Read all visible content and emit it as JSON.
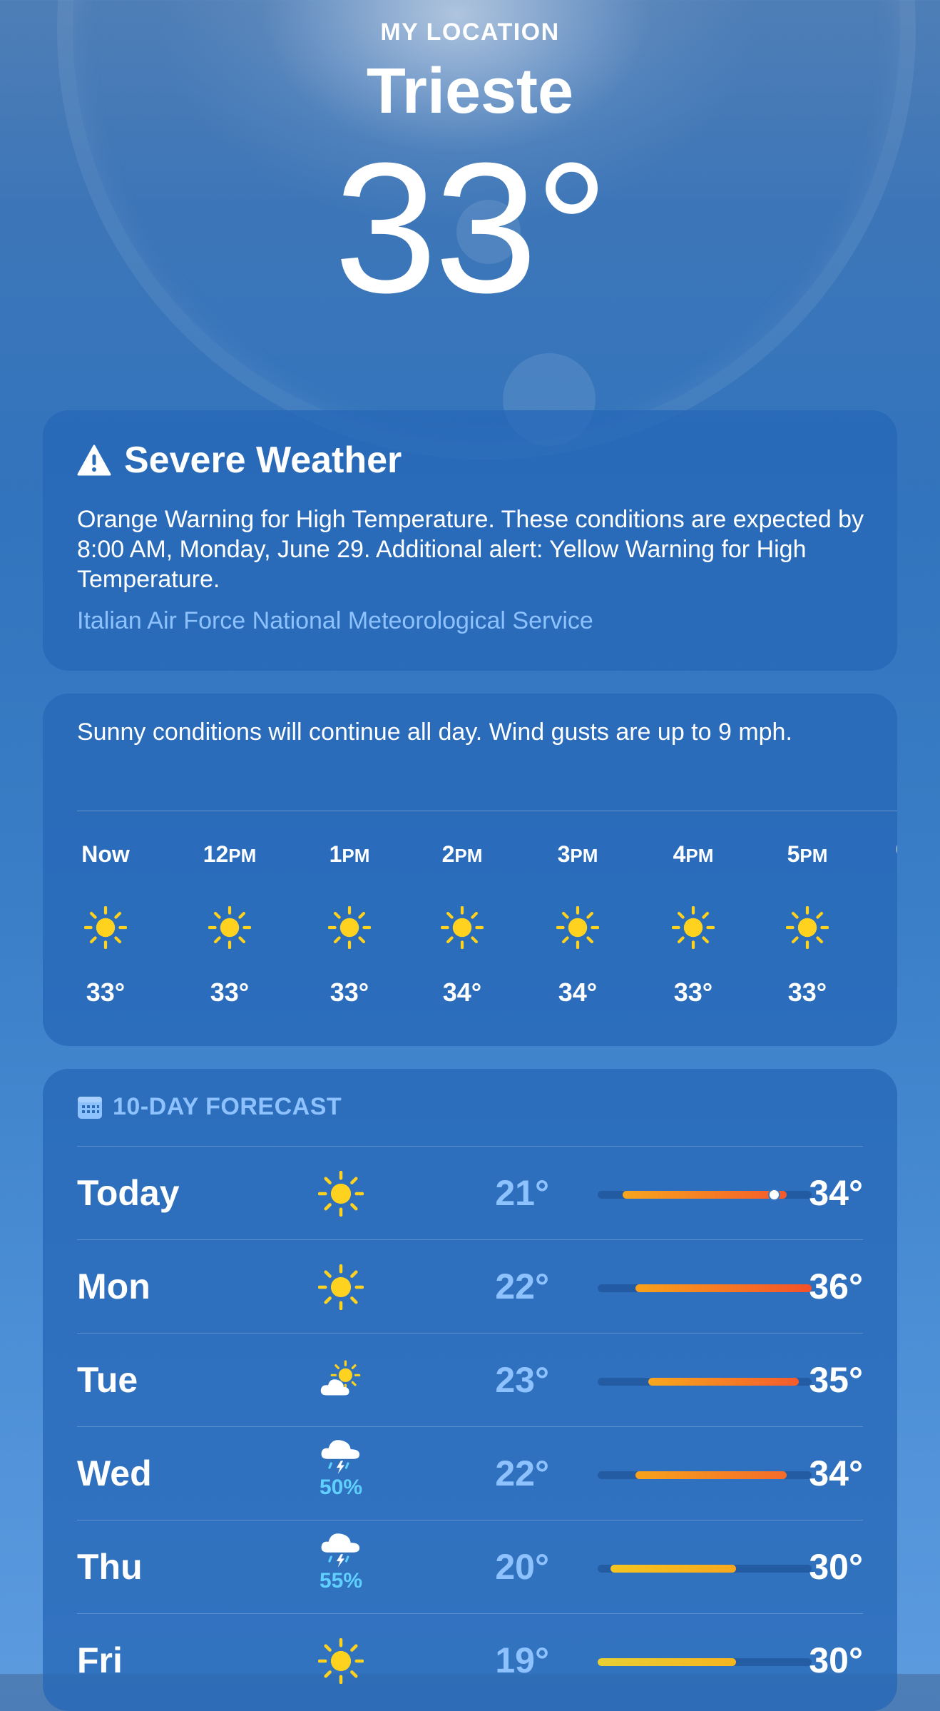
{
  "header": {
    "location_label": "MY LOCATION",
    "city": "Trieste",
    "temperature": "33°"
  },
  "alert": {
    "icon": "warning-triangle-icon",
    "title": "Severe Weather",
    "body": "Orange Warning for High Temperature. These conditions are expected by 8:00 AM, Monday, June 29. Additional alert: Yellow Warning for High Temperature.",
    "source": "Italian Air Force National Meteorological Service",
    "source_color": "#8ec2ff"
  },
  "hourly": {
    "summary": "Sunny conditions will continue all day. Wind gusts are up to 9 mph.",
    "hours": [
      {
        "label": "Now",
        "suffix": "",
        "icon": "sun-icon",
        "temp": "33°"
      },
      {
        "label": "12",
        "suffix": "PM",
        "icon": "sun-icon",
        "temp": "33°"
      },
      {
        "label": "1",
        "suffix": "PM",
        "icon": "sun-icon",
        "temp": "33°"
      },
      {
        "label": "2",
        "suffix": "PM",
        "icon": "sun-icon",
        "temp": "34°"
      },
      {
        "label": "3",
        "suffix": "PM",
        "icon": "sun-icon",
        "temp": "34°"
      },
      {
        "label": "4",
        "suffix": "PM",
        "icon": "sun-icon",
        "temp": "33°"
      },
      {
        "label": "5",
        "suffix": "PM",
        "icon": "sun-icon",
        "temp": "33°"
      }
    ]
  },
  "daily": {
    "icon": "calendar-icon",
    "title": "10-DAY FORECAST",
    "range_min": 19,
    "range_max": 36,
    "days": [
      {
        "name": "Today",
        "icon": "sun-icon",
        "precip": "",
        "low": "21°",
        "high": "34°",
        "low_val": 21,
        "high_val": 34,
        "current_val": 33,
        "bar_colors": [
          "#f7a51e",
          "#f65a2b"
        ]
      },
      {
        "name": "Mon",
        "icon": "sun-icon",
        "precip": "",
        "low": "22°",
        "high": "36°",
        "low_val": 22,
        "high_val": 36,
        "bar_colors": [
          "#f9a21b",
          "#f4502a"
        ]
      },
      {
        "name": "Tue",
        "icon": "partly-cloudy-sun-icon",
        "precip": "",
        "low": "23°",
        "high": "35°",
        "low_val": 23,
        "high_val": 35,
        "bar_colors": [
          "#f8a71e",
          "#f45b2c"
        ]
      },
      {
        "name": "Wed",
        "icon": "thunderstorm-cloud-icon",
        "precip": "50%",
        "low": "22°",
        "high": "34°",
        "low_val": 22,
        "high_val": 34,
        "bar_colors": [
          "#f8a21c",
          "#f46b2a"
        ]
      },
      {
        "name": "Thu",
        "icon": "thunderstorm-cloud-icon",
        "precip": "55%",
        "low": "20°",
        "high": "30°",
        "low_val": 20,
        "high_val": 30,
        "bar_colors": [
          "#f5c520",
          "#f7a81e"
        ]
      },
      {
        "name": "Fri",
        "icon": "sun-icon",
        "precip": "",
        "low": "19°",
        "high": "30°",
        "low_val": 19,
        "high_val": 30,
        "bar_colors": [
          "#e9cf35",
          "#f7b41e"
        ]
      }
    ]
  }
}
